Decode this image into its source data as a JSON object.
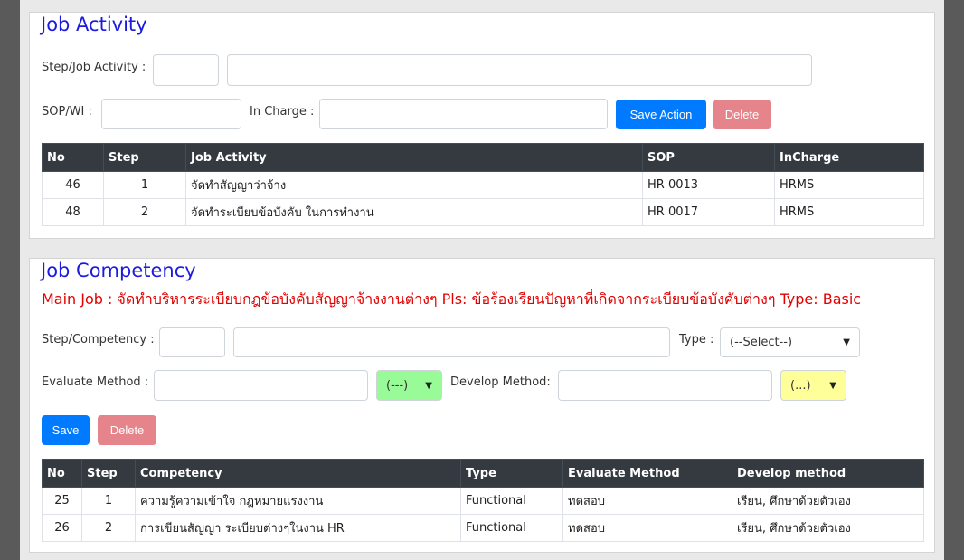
{
  "job_activity": {
    "title": "Job Activity",
    "step_label": "Step/Job Activity :",
    "step_value": "",
    "activity_value": "",
    "sop_label": "SOP/WI :",
    "sop_value": "",
    "incharge_label": "In Charge :",
    "incharge_value": "",
    "save_label": "Save Action",
    "delete_label": "Delete",
    "columns": [
      "No",
      "Step",
      "Job Activity",
      "SOP",
      "InCharge"
    ],
    "rows": [
      {
        "no": "46",
        "step": "1",
        "activity": "จัดทำสัญญาว่าจ้าง",
        "sop": "HR 0013",
        "incharge": "HRMS"
      },
      {
        "no": "48",
        "step": "2",
        "activity": "จัดทำระเบียบข้อบังคับ ในการทำงาน",
        "sop": "HR 0017",
        "incharge": "HRMS"
      }
    ]
  },
  "job_competency": {
    "title": "Job Competency",
    "subtitle": "Main Job : จัดทำบริหารระเบียบกฎข้อบังคับสัญญาจ้างงานต่างๆ Pls: ข้อร้องเรียนปัญหาที่เกิดจากระเบียบข้อบังคับต่างๆ Type: Basic",
    "step_label": "Step/Competency :",
    "type_label": "Type :",
    "type_selected": "(--Select--)",
    "evaluate_label": "Evaluate Method :",
    "evaluate_selected": "(---)",
    "develop_label": "Develop Method:",
    "develop_selected": "(...)",
    "save_label": "Save",
    "delete_label": "Delete",
    "columns": [
      "No",
      "Step",
      "Competency",
      "Type",
      "Evaluate Method",
      "Develop method"
    ],
    "rows": [
      {
        "no": "25",
        "step": "1",
        "competency": "ความรู้ความเข้าใจ กฎหมายแรงงาน",
        "type": "Functional",
        "evaluate": "ทดสอบ",
        "develop": "เรียน, ศึกษาด้วยตัวเอง"
      },
      {
        "no": "26",
        "step": "2",
        "competency": "การเขียนสัญญา ระเบียบต่างๆในงาน HR",
        "type": "Functional",
        "evaluate": "ทดสอบ",
        "develop": "เรียน, ศึกษาด้วยตัวเอง"
      }
    ]
  },
  "colors": {
    "title": "#1a1ae0",
    "subtitle": "#e30000",
    "primary": "#007bff",
    "danger_disabled": "#e6848b",
    "header_bg": "#343a40",
    "evaluate_select_bg": "#98fb98",
    "develop_select_bg": "#ffff99"
  },
  "icons": {
    "select_arrow": "chevron-down-icon"
  }
}
